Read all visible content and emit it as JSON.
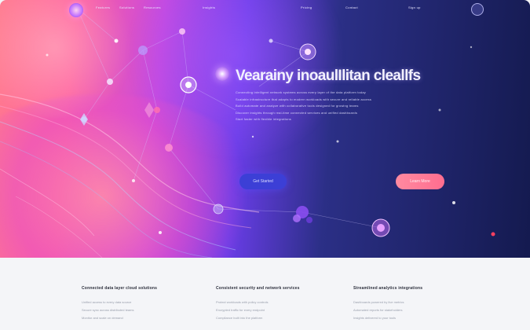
{
  "nav": {
    "links": [
      "Features",
      "Solutions",
      "Resources",
      "Insights",
      "Pricing",
      "Contact",
      "Sign up"
    ]
  },
  "hero": {
    "headline": "Vearainy inoaulIlitan cleallfs",
    "paragraph_lines": [
      "Connecting intelligent network systems across every layer of the data platform today",
      "Scalable infrastructure that adapts to modern workloads with secure and reliable access",
      "Build automate and analyze with collaborative tools designed for growing teams",
      "Discover insights through real-time connected services and unified dashboards",
      "Start faster with flexible integrations"
    ],
    "primary_button": "Get Started",
    "secondary_button": "Learn More"
  },
  "features": [
    {
      "title": "Connected data layer cloud solutions",
      "lines": [
        "Unified access to every data source",
        "Secure sync across distributed teams",
        "Monitor and scale on demand"
      ]
    },
    {
      "title": "Consistent security and network services",
      "lines": [
        "Protect workloads with policy controls",
        "Encrypted traffic for every endpoint",
        "Compliance built into the platform"
      ]
    },
    {
      "title": "Streamlined analytics integrations",
      "lines": [
        "Dashboards powered by live metrics",
        "Automated reports for stakeholders",
        "Insights delivered to your tools"
      ]
    }
  ],
  "colors": {
    "hero_start": "#ff7a8f",
    "hero_end": "#141a4f",
    "primary_button": "#3c3fd6",
    "secondary_button": "#ff6d8f"
  }
}
